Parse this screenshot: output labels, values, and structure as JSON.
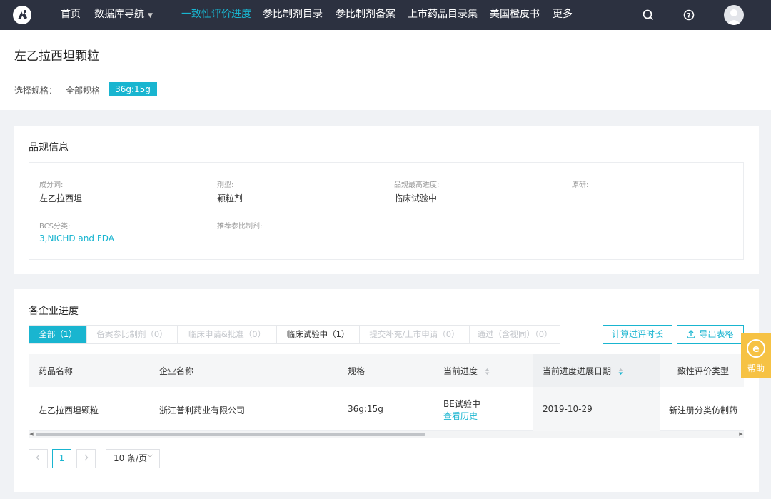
{
  "nav": {
    "items": [
      {
        "label": "首页"
      },
      {
        "label": "数据库导航"
      },
      {
        "label": "一致性评价进度"
      },
      {
        "label": "参比制剂目录"
      },
      {
        "label": "参比制剂备案"
      },
      {
        "label": "上市药品目录集"
      },
      {
        "label": "美国橙皮书"
      },
      {
        "label": "更多"
      }
    ],
    "active_index": 2,
    "icons": [
      "search-icon",
      "help-icon",
      "avatar"
    ]
  },
  "header": {
    "title": "左乙拉西坦颗粒",
    "spec_label": "选择规格：",
    "spec_all": "全部规格",
    "spec_selected": "36g:15g"
  },
  "info": {
    "title": "品规信息",
    "fields": [
      {
        "label": "成分词:",
        "value": "左乙拉西坦"
      },
      {
        "label": "剂型:",
        "value": "颗粒剂"
      },
      {
        "label": "品规最高进度:",
        "value": "临床试验中"
      },
      {
        "label": "原研:",
        "value": ""
      },
      {
        "label": "BCS分类:",
        "value": "3,NICHD and FDA"
      },
      {
        "label": "推荐参比制剂:",
        "value": ""
      }
    ]
  },
  "progress": {
    "title": "各企业进度",
    "tabs": [
      {
        "label": "全部（1）",
        "state": "active"
      },
      {
        "label": "备案参比制剂（0）",
        "state": "disabled"
      },
      {
        "label": "临床申请&批准（0）",
        "state": "disabled"
      },
      {
        "label": "临床试验中（1）",
        "state": "normal"
      },
      {
        "label": "提交补充/上市申请（0）",
        "state": "disabled"
      },
      {
        "label": "通过（含视同）（0）",
        "state": "disabled"
      }
    ],
    "calc_button": "计算过评时长",
    "export_button": "导出表格",
    "table": {
      "headers": [
        "药品名称",
        "企业名称",
        "规格",
        "当前进度",
        "当前进度进展日期",
        "一致性评价类型"
      ],
      "rows": [
        {
          "drug": "左乙拉西坦颗粒",
          "company": "浙江普利药业有限公司",
          "spec": "36g:15g",
          "progress": "BE试验中",
          "history_link": "查看历史",
          "date": "2019-10-29",
          "type": "新注册分类仿制药"
        }
      ]
    },
    "pagination": {
      "current_page": "1",
      "page_size": "10 条/页"
    }
  },
  "help": {
    "label": "帮助"
  },
  "colors": {
    "nav_bg": "#2c3140",
    "accent": "#19b5d0",
    "help_bg": "#f6c244"
  }
}
